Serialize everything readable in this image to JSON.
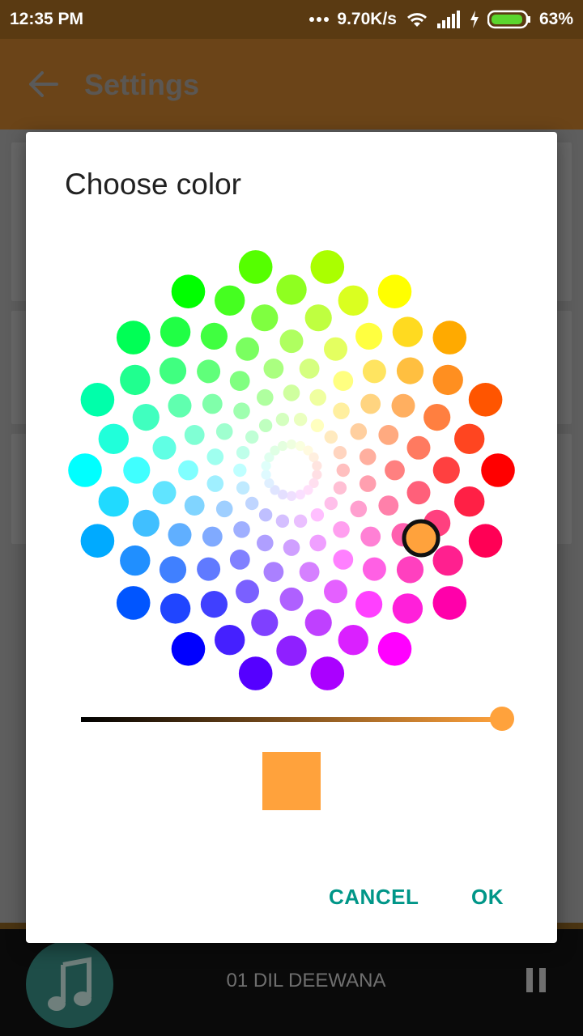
{
  "status_bar": {
    "time": "12:35 PM",
    "network_speed": "9.70K/s",
    "battery": "63%",
    "icons": [
      "more-dots-icon",
      "wifi-icon",
      "signal-icon",
      "charging-icon",
      "battery-icon"
    ]
  },
  "app_bar": {
    "title": "Settings",
    "back_icon": "arrow-left-icon"
  },
  "dialog": {
    "title": "Choose color",
    "selected_color": "#FFA23C",
    "brightness": 1.0,
    "cancel_label": "CANCEL",
    "ok_label": "OK"
  },
  "player": {
    "track": "01 DIL DEEWANA",
    "icons": [
      "music-note-icon",
      "pause-icon"
    ]
  },
  "colors": {
    "accent": "#009688",
    "app_bar": "#6B4418",
    "status_bar": "#5A3A12"
  }
}
